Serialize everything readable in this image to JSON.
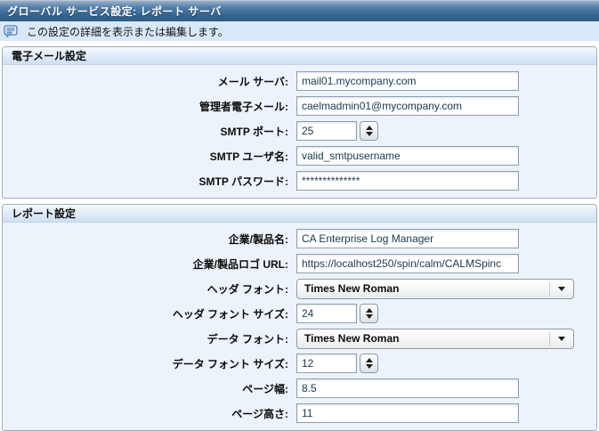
{
  "title_bar": {
    "title": "グローバル サービス設定: レポート サーバ"
  },
  "info_bar": {
    "icon": "comment-icon",
    "text": "この設定の詳細を表示または編集します。"
  },
  "email_section": {
    "header": "電子メール設定",
    "fields": {
      "mail_server": {
        "label": "メール サーバ:",
        "value": "mail01.mycompany.com"
      },
      "admin_email": {
        "label": "管理者電子メール:",
        "value": "caelmadmin01@mycompany.com"
      },
      "smtp_port": {
        "label": "SMTP ポート:",
        "value": "25"
      },
      "smtp_user": {
        "label": "SMTP ユーザ名:",
        "value": "valid_smtpusername"
      },
      "smtp_password": {
        "label": "SMTP パスワード:",
        "value": "**************"
      }
    }
  },
  "report_section": {
    "header": "レポート設定",
    "fields": {
      "company_product_name": {
        "label": "企業/製品名:",
        "value": "CA Enterprise Log Manager"
      },
      "logo_url": {
        "label": "企業/製品ロゴ URL:",
        "value": "https://localhost250/spin/calm/CALMSpinc"
      },
      "header_font": {
        "label": "ヘッダ フォント:",
        "value": "Times New Roman"
      },
      "header_font_size": {
        "label": "ヘッダ フォント サイズ:",
        "value": "24"
      },
      "data_font": {
        "label": "データ フォント:",
        "value": "Times New Roman"
      },
      "data_font_size": {
        "label": "データ フォント サイズ:",
        "value": "12"
      },
      "page_width": {
        "label": "ページ幅:",
        "value": "8.5"
      },
      "page_height": {
        "label": "ページ高さ:",
        "value": "11"
      }
    }
  },
  "icons": {
    "comment_icon": "speech-bubble-with-lines",
    "spinner_up": "triangle-up",
    "spinner_down": "triangle-down",
    "dropdown_arrow": "triangle-down"
  },
  "colors": {
    "titlebar_top": "#9db1c8",
    "titlebar_bottom": "#2f5d88",
    "infobar_bg": "#d9e8f8",
    "section_bg": "#edf3fb",
    "section_header_bg": "#dcebf9",
    "input_text": "#17394d"
  }
}
